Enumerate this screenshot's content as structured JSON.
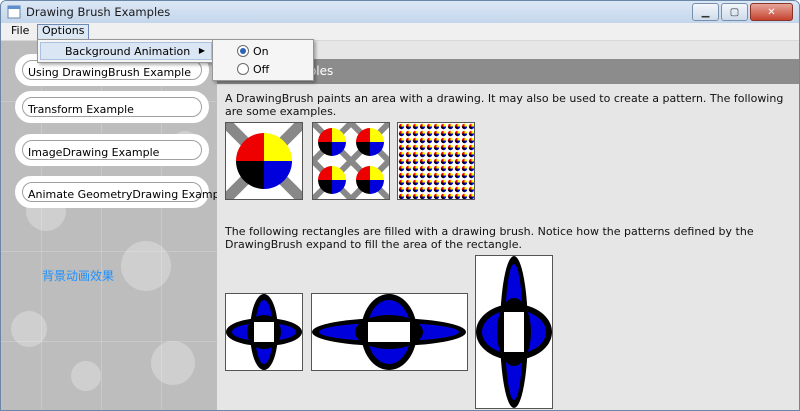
{
  "window": {
    "title": "Drawing Brush Examples"
  },
  "menubar": {
    "items": [
      {
        "label": "File"
      },
      {
        "label": "Options"
      }
    ]
  },
  "options_menu": {
    "background_animation_label": "Background Animation",
    "submenu": [
      {
        "label": "On",
        "checked": true
      },
      {
        "label": "Off",
        "checked": false
      }
    ]
  },
  "sidebar": {
    "buttons": [
      {
        "label": "Using DrawingBrush Example"
      },
      {
        "label": "Transform Example"
      },
      {
        "label": "ImageDrawing Example"
      },
      {
        "label": "Animate GeometryDrawing Example"
      }
    ],
    "effect_label": "背景动画效果"
  },
  "content": {
    "header_title_fragment": "mples",
    "intro_text": "A DrawingBrush paints an area with a drawing. It may also be used to create a pattern. The following are some examples.",
    "rect_text": "The following rectangles are filled with a drawing brush. Notice how the patterns defined by the DrawingBrush expand to fill the area of the rectangle."
  },
  "colors": {
    "blue": "#0000dd",
    "red": "#ee0000",
    "yellow": "#ffff00",
    "gray": "#888888",
    "black": "#000000",
    "link_blue": "#1e90ff"
  }
}
